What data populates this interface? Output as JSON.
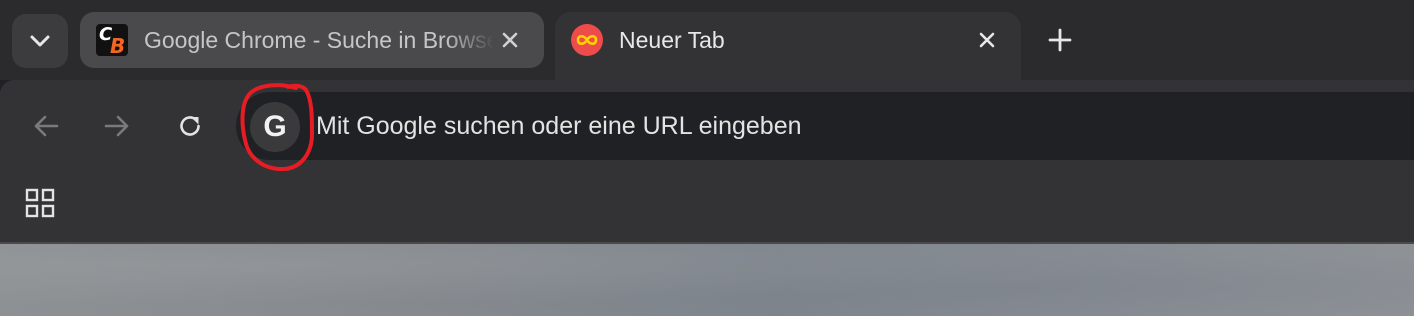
{
  "tabs": [
    {
      "title": "Google Chrome - Suche in Browsern",
      "favicon": "computerbild-favicon",
      "favicon_letters": [
        "C",
        "B"
      ],
      "active": false
    },
    {
      "title": "Neuer Tab",
      "favicon": "infinity-favicon",
      "active": true
    }
  ],
  "toolbar": {
    "back_icon": "arrow-left-icon",
    "forward_icon": "arrow-right-icon",
    "reload_icon": "reload-icon"
  },
  "omnibox": {
    "search_engine_letter": "G",
    "placeholder": "Mit Google suchen oder eine URL eingeben"
  },
  "bookmarks": {
    "apps_icon": "apps-grid-icon"
  },
  "colors": {
    "tabstrip": "#2b2b2d",
    "toolbar": "#333335",
    "omnibox": "#202124",
    "annotation": "#e81c24",
    "infinity_favicon_bg": "#ee4b4b",
    "infinity_favicon_fg": "#ffd400",
    "cb_orange": "#f26522"
  }
}
